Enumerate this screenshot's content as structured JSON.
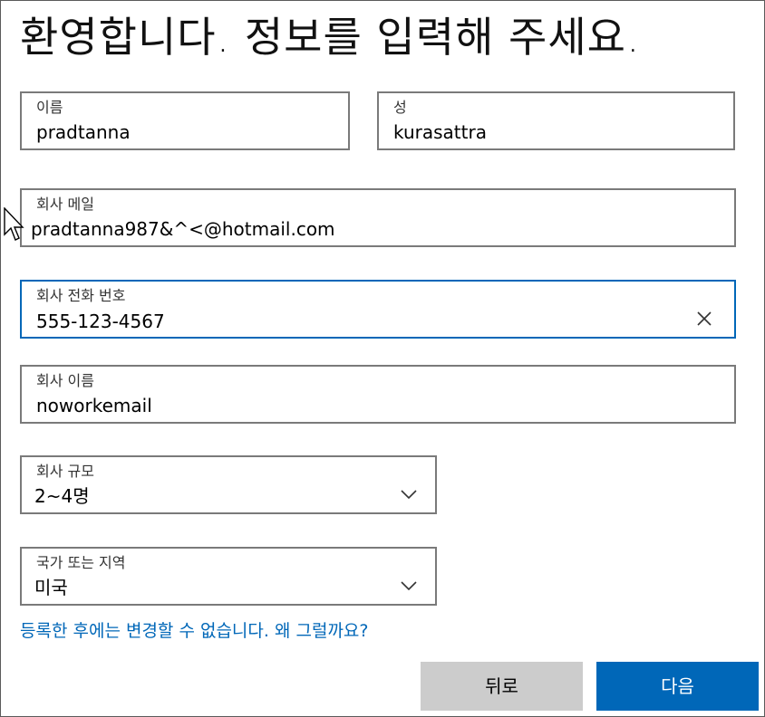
{
  "title": "환영합니다. 정보를 입력해 주세요.",
  "fields": {
    "first_name": {
      "label": "이름",
      "value": "pradtanna"
    },
    "last_name": {
      "label": "성",
      "value": "kurasattra"
    },
    "work_email": {
      "label": "회사 메일",
      "value": "pradtanna987&^<@hotmail.com"
    },
    "work_phone": {
      "label": "회사 전화 번호",
      "value": "555-123-4567"
    },
    "company_name": {
      "label": "회사 이름",
      "value": "noworkemail"
    },
    "company_size": {
      "label": "회사 규모",
      "value": "2~4명"
    },
    "country": {
      "label": "국가 또는 지역",
      "value": "미국"
    }
  },
  "link_text": "등록한 후에는 변경할 수 없습니다. 왜 그럴까요?",
  "buttons": {
    "back": "뒤로",
    "next": "다음"
  },
  "colors": {
    "accent": "#0067b8",
    "back_button_bg": "#cccccc"
  },
  "icons": {
    "clear": "close-icon",
    "dropdown": "chevron-down-icon",
    "cursor": "mouse-pointer-icon"
  }
}
